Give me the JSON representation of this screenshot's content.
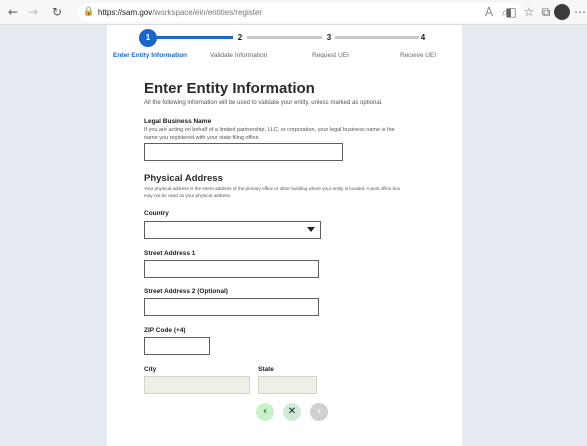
{
  "browser": {
    "url_host": "https://sam.gov",
    "url_path": "/workspace/ein/entities/register",
    "icons": [
      "back-icon",
      "forward-icon",
      "refresh-icon",
      "lock-icon",
      "read-aloud-icon",
      "zoom-icon",
      "extension-icon",
      "collections-icon",
      "favorites-icon",
      "profile-avatar",
      "more-icon"
    ]
  },
  "stepper": {
    "steps": [
      {
        "number": "1",
        "label": "Enter Entity Information",
        "state": "active"
      },
      {
        "number": "2",
        "label": "Validate Information",
        "state": "upcoming"
      },
      {
        "number": "3",
        "label": "Request UEI",
        "state": "upcoming"
      },
      {
        "number": "4",
        "label": "Receive UEI",
        "state": "upcoming"
      }
    ]
  },
  "form": {
    "title": "Enter Entity Information",
    "intro": "All the following information will be used to validate your entity, unless marked as optional.",
    "legal_name": {
      "label": "Legal Business Name",
      "help": "If you are acting on behalf of a limited partnership, LLC, or corporation, your legal business name is the name you registered with your state filing office.",
      "value": ""
    },
    "physical_address": {
      "title": "Physical Address",
      "help": "Your physical address is the street address of the primary office or other building where your entity is located. A post office box may not be used as your physical address."
    },
    "country": {
      "label": "Country",
      "value": ""
    },
    "street1": {
      "label": "Street Address 1",
      "value": ""
    },
    "street2": {
      "label": "Street Address 2 (Optional)",
      "value": ""
    },
    "zip": {
      "label": "ZIP Code (+4)",
      "value": ""
    },
    "city": {
      "label": "City",
      "value": ""
    },
    "state": {
      "label": "State",
      "value": ""
    }
  },
  "nav": {
    "back": "‹",
    "cancel": "✕",
    "next": "›"
  },
  "colors": {
    "accent": "#1a66c9",
    "back_button": "#c9f0c9",
    "cancel_button": "#cfead6",
    "next_button": "#d0d0d0",
    "page_bg": "#e6ebf2"
  }
}
